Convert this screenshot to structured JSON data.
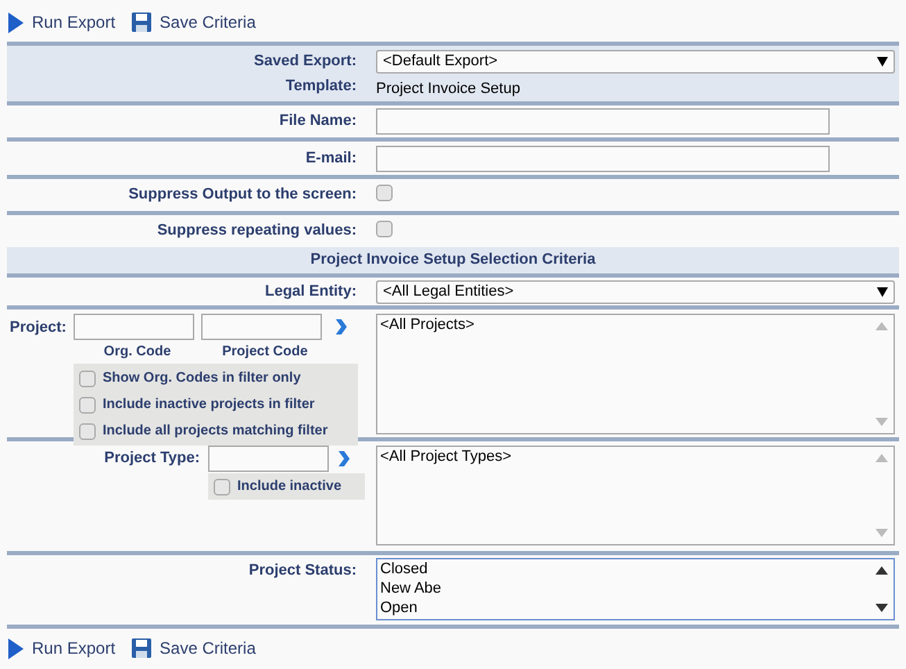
{
  "toolbar_top": [
    {
      "kind": "run",
      "label": "Run Export"
    },
    {
      "kind": "save",
      "label": "Save Criteria"
    }
  ],
  "saved_export": {
    "label": "Saved Export:",
    "value": "<Default Export>"
  },
  "template": {
    "label": "Template:",
    "value": "Project Invoice Setup"
  },
  "file_name": {
    "label": "File Name:"
  },
  "email": {
    "label": "E-mail:"
  },
  "suppress_output": {
    "label": "Suppress Output to the screen:",
    "checked": false
  },
  "suppress_repeating": {
    "label": "Suppress repeating values:",
    "checked": false
  },
  "section_title": "Project Invoice Setup Selection Criteria",
  "legal_entity": {
    "label": "Legal Entity:",
    "value": "<All Legal Entities>"
  },
  "project": {
    "label": "Project:",
    "filter_labels": [
      "Org. Code",
      "Project Code"
    ],
    "options": [
      {
        "label": "Show Org. Codes in filter only",
        "checked": false
      },
      {
        "label": "Include inactive projects in filter",
        "checked": false
      },
      {
        "label": "Include all projects matching filter",
        "checked": false
      }
    ],
    "list": [
      "<All Projects>"
    ]
  },
  "project_type": {
    "label": "Project Type:",
    "options": [
      {
        "label": "Include inactive",
        "checked": false
      }
    ],
    "list": [
      "<All Project Types>"
    ]
  },
  "project_status": {
    "label": "Project Status:",
    "list": [
      "Closed",
      "New Abe",
      "Open"
    ]
  },
  "toolbar_bottom": [
    {
      "kind": "run",
      "label": "Run Export"
    },
    {
      "kind": "save",
      "label": "Save Criteria"
    }
  ]
}
